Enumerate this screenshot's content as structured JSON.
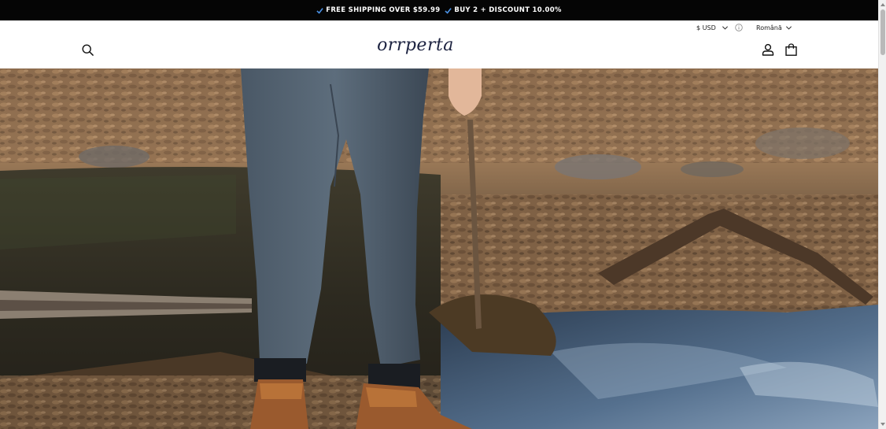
{
  "announcement": {
    "items": [
      {
        "icon": "check-icon",
        "text": "FREE SHIPPING OVER $59.99"
      },
      {
        "icon": "check-icon",
        "text": "BUY 2 + DISCOUNT 10.00%"
      }
    ],
    "check_color": "#4a90e2"
  },
  "header": {
    "currency_label": "$ USD",
    "language_label": "Română",
    "logo_text": "orrperta"
  },
  "hero": {
    "image_subject": "person-standing-in-forest-creek"
  },
  "colors": {
    "announcement_bg": "#050505",
    "logo": "#1c2240"
  }
}
